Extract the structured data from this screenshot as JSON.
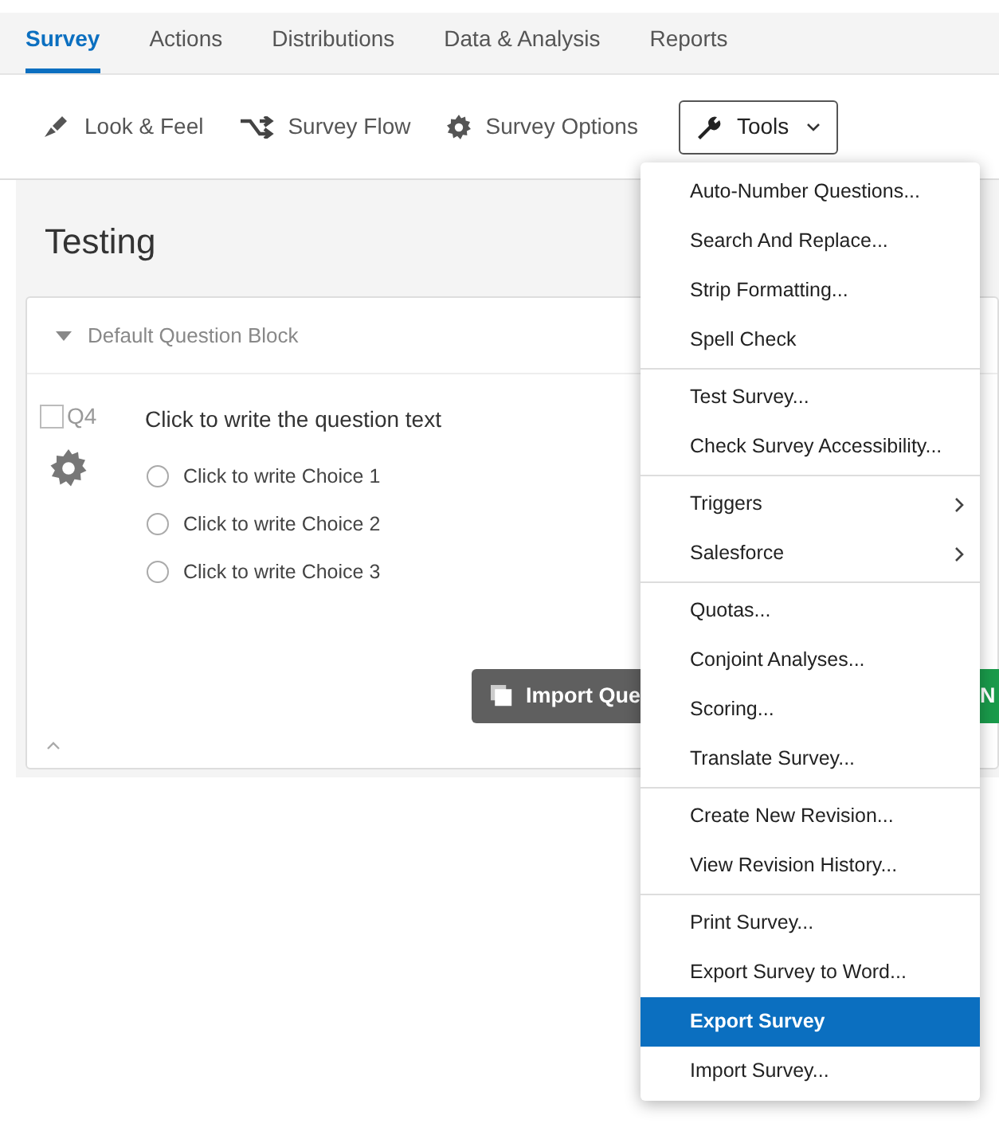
{
  "tabs": [
    {
      "label": "Survey",
      "selected": true
    },
    {
      "label": "Actions",
      "selected": false
    },
    {
      "label": "Distributions",
      "selected": false
    },
    {
      "label": "Data & Analysis",
      "selected": false
    },
    {
      "label": "Reports",
      "selected": false
    }
  ],
  "toolbar": [
    {
      "kind": "brush",
      "label": "Look & Feel"
    },
    {
      "kind": "flow",
      "label": "Survey Flow"
    },
    {
      "kind": "gear",
      "label": "Survey Options"
    },
    {
      "kind": "wrench",
      "label": "Tools",
      "expanded": true
    }
  ],
  "survey_title": "Testing",
  "block": {
    "title": "Default Question Block",
    "expanded": true,
    "question": {
      "number": "Q4",
      "checked": false,
      "text": "Click to write the question text",
      "choices": [
        {
          "label": "Click to write Choice 1",
          "selected": false
        },
        {
          "label": "Click to write Choice 2",
          "selected": false
        },
        {
          "label": "Click to write Choice 3",
          "selected": false
        }
      ]
    },
    "import_button": "Import Que",
    "new_button": "N"
  },
  "tools_menu": [
    [
      {
        "label": "Auto-Number Questions...",
        "submenu": false,
        "selected": false
      },
      {
        "label": "Search And Replace...",
        "submenu": false,
        "selected": false
      },
      {
        "label": "Strip Formatting...",
        "submenu": false,
        "selected": false
      },
      {
        "label": "Spell Check",
        "submenu": false,
        "selected": false
      }
    ],
    [
      {
        "label": "Test Survey...",
        "submenu": false,
        "selected": false
      },
      {
        "label": "Check Survey Accessibility...",
        "submenu": false,
        "selected": false
      }
    ],
    [
      {
        "label": "Triggers",
        "submenu": true,
        "selected": false
      },
      {
        "label": "Salesforce",
        "submenu": true,
        "selected": false
      }
    ],
    [
      {
        "label": "Quotas...",
        "submenu": false,
        "selected": false
      },
      {
        "label": "Conjoint Analyses...",
        "submenu": false,
        "selected": false
      },
      {
        "label": "Scoring...",
        "submenu": false,
        "selected": false
      },
      {
        "label": "Translate Survey...",
        "submenu": false,
        "selected": false
      }
    ],
    [
      {
        "label": "Create New Revision...",
        "submenu": false,
        "selected": false
      },
      {
        "label": "View Revision History...",
        "submenu": false,
        "selected": false
      }
    ],
    [
      {
        "label": "Print Survey...",
        "submenu": false,
        "selected": false
      },
      {
        "label": "Export Survey to Word...",
        "submenu": false,
        "selected": false
      },
      {
        "label": "Export Survey",
        "submenu": false,
        "selected": true
      },
      {
        "label": "Import Survey...",
        "submenu": false,
        "selected": false
      }
    ]
  ]
}
